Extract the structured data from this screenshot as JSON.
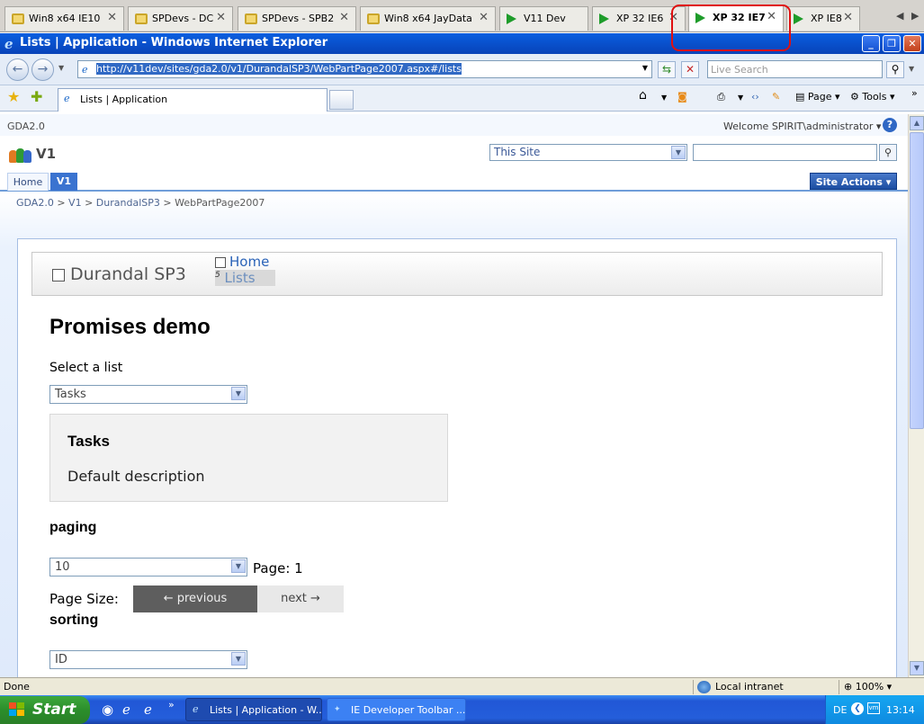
{
  "vm_tabs": [
    {
      "label": "Win8 x64 IE10",
      "icon": "lock-icon"
    },
    {
      "label": "SPDevs - DC",
      "icon": "lock-icon"
    },
    {
      "label": "SPDevs - SPB2",
      "icon": "lock-icon"
    },
    {
      "label": "Win8 x64 JayData",
      "icon": "lock-icon"
    },
    {
      "label": "V11 Dev",
      "icon": "play-icon"
    },
    {
      "label": "XP 32 IE6",
      "icon": "play-icon"
    },
    {
      "label": "XP 32 IE7",
      "icon": "play-icon",
      "active": true
    },
    {
      "label": "XP IE8",
      "icon": "play-icon"
    }
  ],
  "window": {
    "title": "Lists | Application - Windows Internet Explorer"
  },
  "addressbar": {
    "url": "http://v11dev/sites/gda2.0/v1/DurandalSP3/WebPartPage2007.aspx#/lists",
    "search_placeholder": "Live Search"
  },
  "commandbar": {
    "tab_title": "Lists | Application",
    "page_label": "Page",
    "tools_label": "Tools"
  },
  "sharepoint": {
    "site_code": "GDA2.0",
    "welcome": "Welcome SPIRIT\\administrator",
    "site_title": "V1",
    "scope": "This Site",
    "nav": {
      "home": "Home",
      "current": "V1"
    },
    "site_actions": "Site Actions",
    "breadcrumb": [
      "GDA2.0",
      "V1",
      "DurandalSP3",
      "WebPartPage2007"
    ]
  },
  "app": {
    "brand": "Durandal SP3",
    "nav_home": "Home",
    "nav_lists": "Lists",
    "nav_lists_badge": "5",
    "heading": "Promises demo",
    "select_label": "Select a list",
    "selected_list": "Tasks",
    "info_title": "Tasks",
    "info_description": "Default description",
    "paging_title": "paging",
    "page_size_value": "10",
    "page_label": "Page: 1",
    "page_size_label": "Page Size:",
    "prev_label": "← previous",
    "next_label": "next →",
    "sorting_title": "sorting",
    "sort_value": "ID"
  },
  "statusbar": {
    "status": "Done",
    "zone": "Local intranet",
    "zoom": "100%"
  },
  "taskbar": {
    "start": "Start",
    "tasks": [
      "Lists | Application - W...",
      "IE Developer Toolbar ..."
    ],
    "lang": "DE",
    "clock": "13:14"
  },
  "colors": {
    "ie_titlebar": "#0a5fe0",
    "sp_nav_active": "#3a73d0",
    "prev_button": "#5e5e5e",
    "tab_highlight": "#e01010"
  }
}
